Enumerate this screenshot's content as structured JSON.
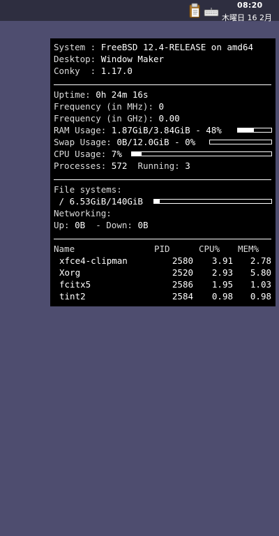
{
  "panel": {
    "icons": [
      "clipboard-icon",
      "keyboard-icon"
    ],
    "time": "08:20",
    "date": "木曜日 16 2月"
  },
  "conky": {
    "system_label": "System :",
    "system_value": "FreeBSD 12.4-RELEASE on amd64",
    "desktop_label": "Desktop:",
    "desktop_value": "Window Maker",
    "conky_label": "Conky  :",
    "conky_value": "1.17.0",
    "uptime_label": "Uptime:",
    "uptime_value": "0h 24m 16s",
    "freq_mhz_label": "Frequency (in MHz):",
    "freq_mhz_value": "0",
    "freq_ghz_label": "Frequency (in GHz):",
    "freq_ghz_value": "0.00",
    "ram_label": "RAM Usage:",
    "ram_value": "1.87GiB/3.84GiB - 48%",
    "ram_fraction": 0.48,
    "swap_label": "Swap Usage:",
    "swap_value": "0B/12.0GiB - 0%",
    "swap_fraction": 0.0,
    "cpu_label": "CPU Usage:",
    "cpu_value": "7%",
    "cpu_fraction": 0.07,
    "processes_label": "Processes:",
    "processes_value": "572",
    "running_label": "Running:",
    "running_value": "3",
    "fs_label": "File systems:",
    "fs_mount": "/",
    "fs_value": "6.53GiB/140GiB",
    "fs_fraction": 0.047,
    "net_label": "Networking:",
    "up_label": "Up:",
    "up_value": "0B",
    "down_label": "- Down:",
    "down_value": "0B",
    "proc_headers": [
      "Name",
      "PID",
      "CPU%",
      "MEM%"
    ],
    "proc_rows": [
      {
        "name": "xfce4-clipman",
        "pid": "2580",
        "cpu": "3.91",
        "mem": "2.78"
      },
      {
        "name": "Xorg",
        "pid": "2520",
        "cpu": "2.93",
        "mem": "5.80"
      },
      {
        "name": "fcitx5",
        "pid": "2586",
        "cpu": "1.95",
        "mem": "1.03"
      },
      {
        "name": "tint2",
        "pid": "2584",
        "cpu": "0.98",
        "mem": "0.98"
      }
    ]
  }
}
